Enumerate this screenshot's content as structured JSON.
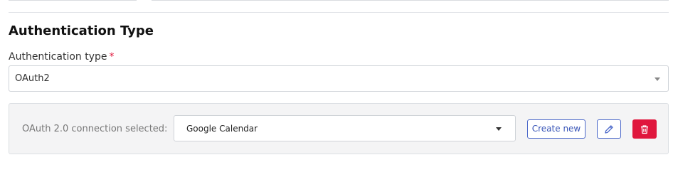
{
  "section": {
    "title": "Authentication Type"
  },
  "auth_type": {
    "label": "Authentication type",
    "required_marker": "*",
    "value": "OAuth2"
  },
  "connection": {
    "label": "OAuth 2.0 connection selected:",
    "value": "Google Calendar",
    "create_label": "Create new",
    "edit_icon": "pencil-icon",
    "delete_icon": "trash-icon"
  },
  "colors": {
    "accent": "#4a67c9",
    "danger": "#e0173d",
    "required": "#e0173d"
  }
}
